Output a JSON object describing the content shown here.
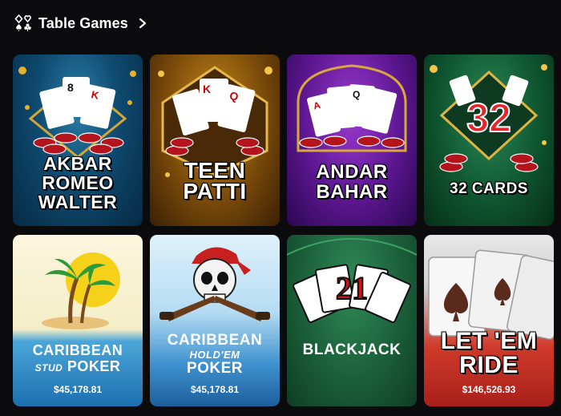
{
  "header": {
    "title": "Table Games",
    "icon": "card-suits-icon",
    "chevron": "chevron-right-icon"
  },
  "games": [
    {
      "lines": [
        "AKBAR",
        "ROMEO",
        "WALTER"
      ],
      "jackpot": ""
    },
    {
      "lines": [
        "TEEN",
        "PATTI"
      ],
      "jackpot": ""
    },
    {
      "lines": [
        "ANDAR",
        "BAHAR"
      ],
      "jackpot": ""
    },
    {
      "lines": [
        "32 CARDS"
      ],
      "badge": "32",
      "jackpot": ""
    },
    {
      "lines": [
        "CARIBBEAN",
        "STUD",
        "POKER"
      ],
      "jackpot": "$45,178.81"
    },
    {
      "lines": [
        "CARIBBEAN",
        "HOLD'EM",
        "POKER"
      ],
      "jackpot": "$45,178.81"
    },
    {
      "lines": [
        "BLACKJACK"
      ],
      "badge": "21",
      "jackpot": ""
    },
    {
      "lines": [
        "LET 'EM",
        "RIDE"
      ],
      "jackpot": "$146,526.93"
    }
  ],
  "colors": {
    "background": "#0b0b0d",
    "text": "#ffffff"
  }
}
